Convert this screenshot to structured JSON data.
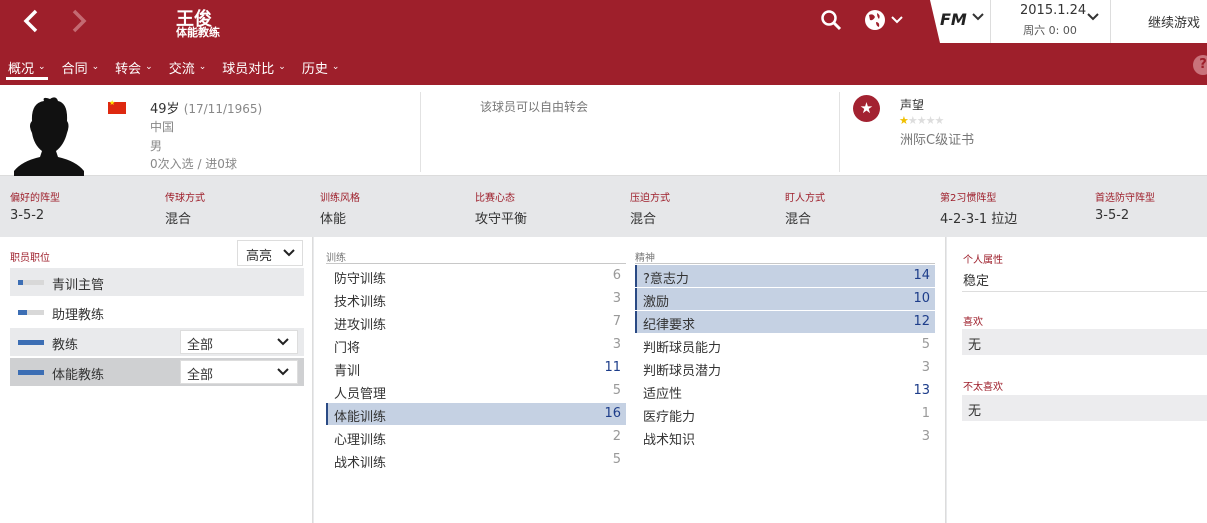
{
  "header": {
    "name": "王俊",
    "role": "体能教练",
    "date": "2015.1.24",
    "time": "周六 0: 00",
    "fm_logo": "FM",
    "continue_label": "继续游戏",
    "menu": [
      "概况",
      "合同",
      "转会",
      "交流",
      "球员对比",
      "历史"
    ],
    "help": "?"
  },
  "profile": {
    "age": "49岁",
    "dob": "(17/11/1965)",
    "nationality": "中国",
    "gender": "男",
    "caps": "0次入选 / 进0球",
    "transfer_status": "该球员可以自由转会",
    "reputation_label": "声望",
    "reputation_stars": 0.5,
    "licence": "洲际C级证书"
  },
  "tactics": [
    {
      "label": "偏好的阵型",
      "value": "3-5-2"
    },
    {
      "label": "传球方式",
      "value": "混合"
    },
    {
      "label": "训练风格",
      "value": "体能"
    },
    {
      "label": "比赛心态",
      "value": "攻守平衡"
    },
    {
      "label": "压迫方式",
      "value": "混合"
    },
    {
      "label": "盯人方式",
      "value": "混合"
    },
    {
      "label": "第2习惯阵型",
      "value": "4-2-3-1 拉边"
    },
    {
      "label": "首选防守阵型",
      "value": "3-5-2"
    }
  ],
  "staff_roles": {
    "label": "职员职位",
    "highlight_select": "高亮",
    "roles": [
      {
        "name": "青训主管",
        "level": 0.2,
        "select": ""
      },
      {
        "name": "助理教练",
        "level": 0.35,
        "select": ""
      },
      {
        "name": "教练",
        "level": 1.0,
        "select": "全部"
      },
      {
        "name": "体能教练",
        "level": 1.0,
        "select": "全部"
      }
    ]
  },
  "training": {
    "header": "训练",
    "rows": [
      {
        "name": "防守训练",
        "value": "6"
      },
      {
        "name": "技术训练",
        "value": "3"
      },
      {
        "name": "进攻训练",
        "value": "7"
      },
      {
        "name": "门将",
        "value": "3"
      },
      {
        "name": "青训",
        "value": "11"
      },
      {
        "name": "人员管理",
        "value": "5"
      },
      {
        "name": "体能训练",
        "value": "16"
      },
      {
        "name": "心理训练",
        "value": "2"
      },
      {
        "name": "战术训练",
        "value": "5"
      }
    ]
  },
  "mental": {
    "header": "精神",
    "rows": [
      {
        "name": "?意志力",
        "value": "14"
      },
      {
        "name": "激励",
        "value": "10"
      },
      {
        "name": "纪律要求",
        "value": "12"
      },
      {
        "name": "判断球员能力",
        "value": "5"
      },
      {
        "name": "判断球员潜力",
        "value": "3"
      },
      {
        "name": "适应性",
        "value": "13"
      },
      {
        "name": "医疗能力",
        "value": "1"
      },
      {
        "name": "战术知识",
        "value": "3"
      }
    ]
  },
  "personal": {
    "attr_label": "个人属性",
    "attr_value": "稳定",
    "likes_label": "喜欢",
    "likes_value": "无",
    "dislikes_label": "不太喜欢",
    "dislikes_value": "无"
  },
  "colors": {
    "brand": "#9e1f2b",
    "highlight": "#c5d1e3",
    "high_value": "#1d3d8a",
    "bar": "#3c6eb4"
  }
}
